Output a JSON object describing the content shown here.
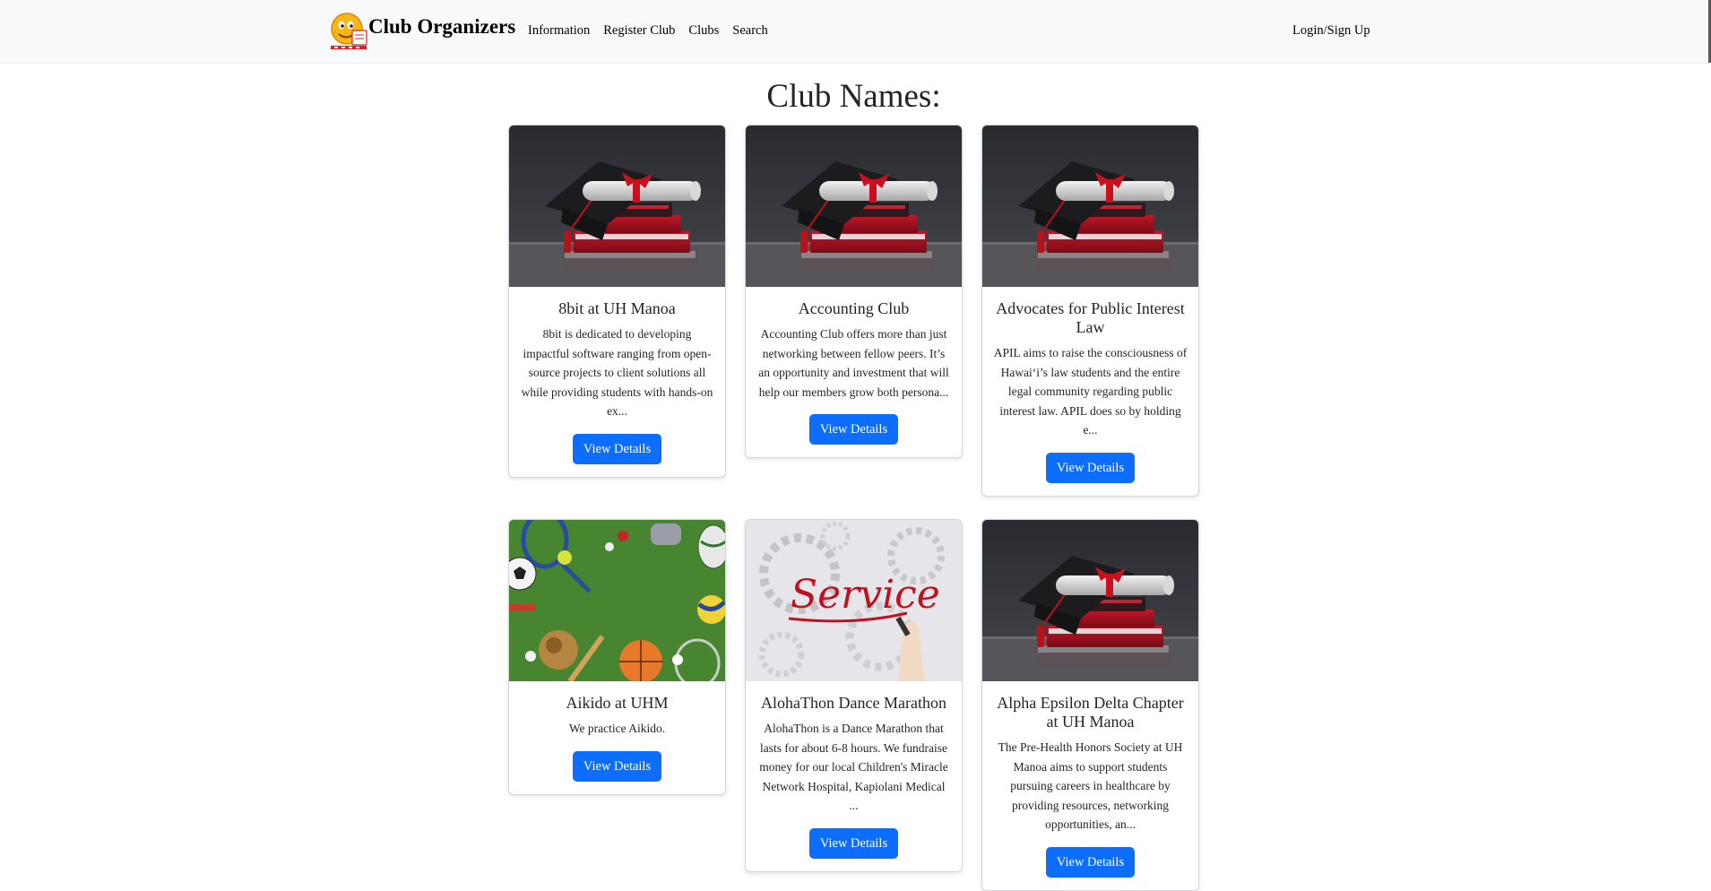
{
  "nav": {
    "brand": "Club Organizers",
    "links": [
      "Information",
      "Register Club",
      "Clubs",
      "Search"
    ],
    "login": "Login/Sign Up"
  },
  "page": {
    "title": "Club Names:"
  },
  "clubs": [
    {
      "name": "8bit at UH Manoa",
      "description": "8bit is dedicated to developing impactful software ranging from open-source projects to client solutions all while providing students with hands-on ex...",
      "image": "graduation-cap-books",
      "button": "View Details"
    },
    {
      "name": "Accounting Club",
      "description": "Accounting Club offers more than just networking between fellow peers. It’s an opportunity and investment that will help our members grow both persona...",
      "image": "graduation-cap-books",
      "button": "View Details"
    },
    {
      "name": "Advocates for Public Interest Law",
      "description": "APIL aims to raise the consciousness of Hawai‘i’s law students and the entire legal community regarding public interest law. APIL does so by holding e...",
      "image": "graduation-cap-books",
      "button": "View Details"
    },
    {
      "name": "Aikido at UHM",
      "description": "We practice Aikido.",
      "image": "sports-equipment-grass",
      "button": "View Details"
    },
    {
      "name": "AlohaThon Dance Marathon",
      "description": "AlohaThon is a Dance Marathon that lasts for about 6-8 hours. We fundraise money for our local Children's Miracle Network Hospital, Kapiolani Medical ...",
      "image": "service-handwriting",
      "image_text": "Service",
      "button": "View Details"
    },
    {
      "name": "Alpha Epsilon Delta Chapter at UH Manoa",
      "description": "The Pre-Health Honors Society at UH Manoa aims to support students pursuing careers in healthcare by providing resources, networking opportunities, an...",
      "image": "graduation-cap-books",
      "button": "View Details"
    }
  ],
  "colors": {
    "primary": "#0d6efd",
    "navbar": "#f8f9fa"
  }
}
